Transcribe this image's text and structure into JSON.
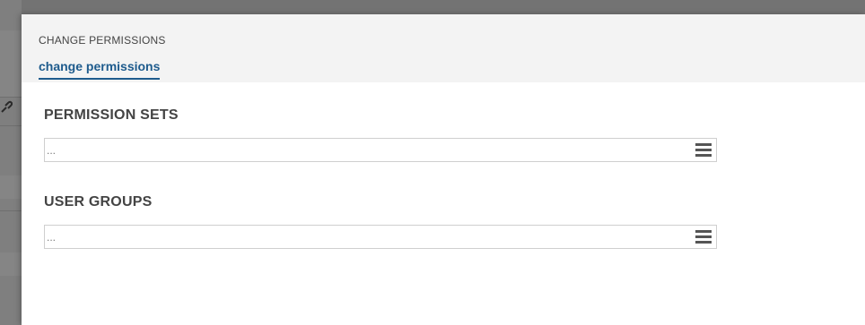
{
  "modal": {
    "title": "CHANGE PERMISSIONS",
    "tab_label": "change permissions"
  },
  "sections": {
    "permission_sets": {
      "heading": "PERMISSION SETS",
      "placeholder": "..."
    },
    "user_groups": {
      "heading": "USER GROUPS",
      "placeholder": "..."
    }
  },
  "icons": {
    "list": "hamburger-menu-icon",
    "background": "link-icon"
  },
  "colors": {
    "accent": "#1e5b8d",
    "overlay": "#7a7a7a",
    "header_bg": "#f3f3f3"
  }
}
